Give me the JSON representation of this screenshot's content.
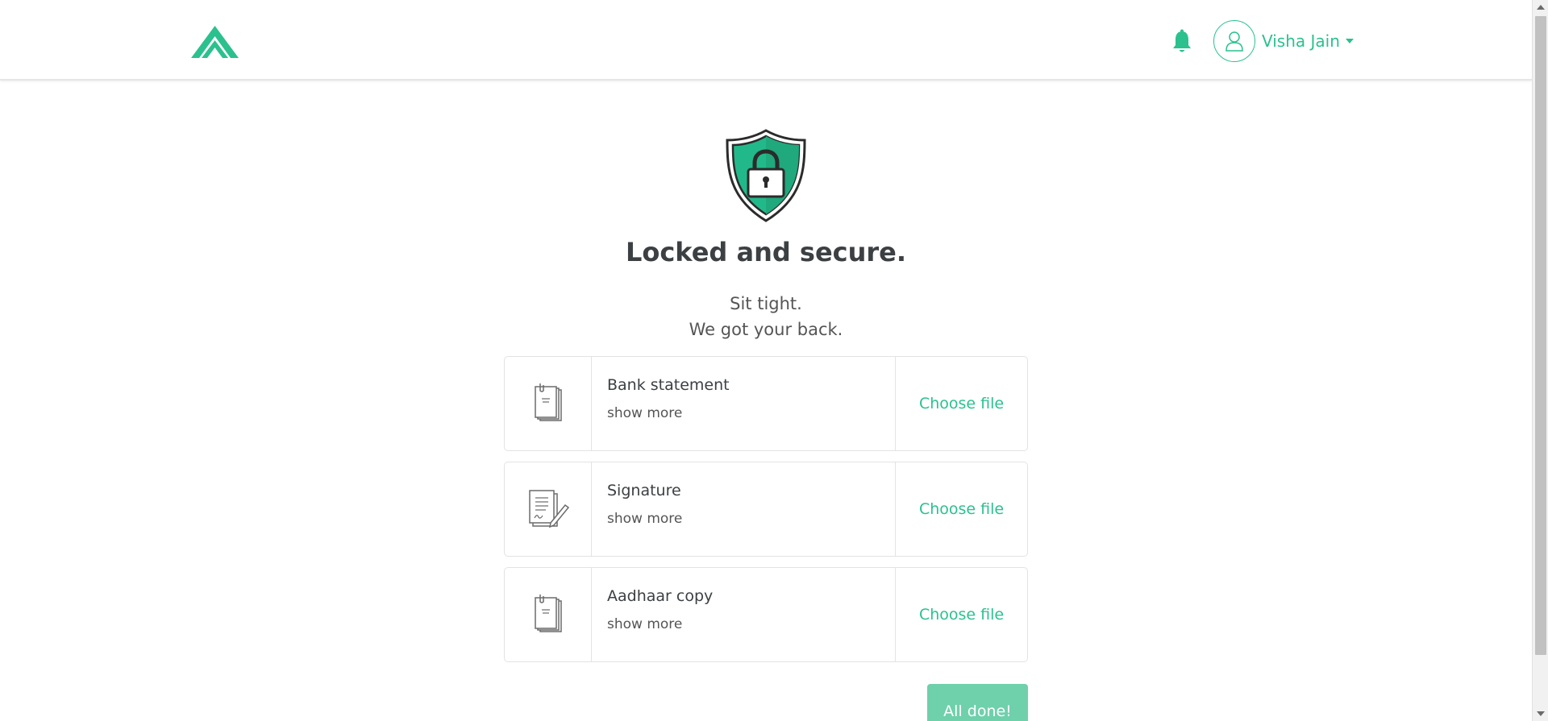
{
  "header": {
    "logo_icon": "brand-logo",
    "notification_icon": "bell-icon",
    "user": {
      "avatar_icon": "user-icon",
      "name": "Visha Jain",
      "menu_icon": "caret-down-icon"
    }
  },
  "main": {
    "hero_icon": "shield-lock-icon",
    "title": "Locked and secure.",
    "subtitle_line1": "Sit tight.",
    "subtitle_line2": "We got your back."
  },
  "documents": [
    {
      "name": "Bank statement",
      "show_more": "show more",
      "action": "Choose file",
      "icon": "document-stack-icon"
    },
    {
      "name": "Signature",
      "show_more": "show more",
      "action": "Choose file",
      "icon": "signature-document-icon"
    },
    {
      "name": "Aadhaar copy",
      "show_more": "show more",
      "action": "Choose file",
      "icon": "document-stack-icon"
    }
  ],
  "done_button": "All done!",
  "colors": {
    "accent": "#2bc18e",
    "button": "#6fd0ac",
    "border": "#e3e3e3"
  }
}
